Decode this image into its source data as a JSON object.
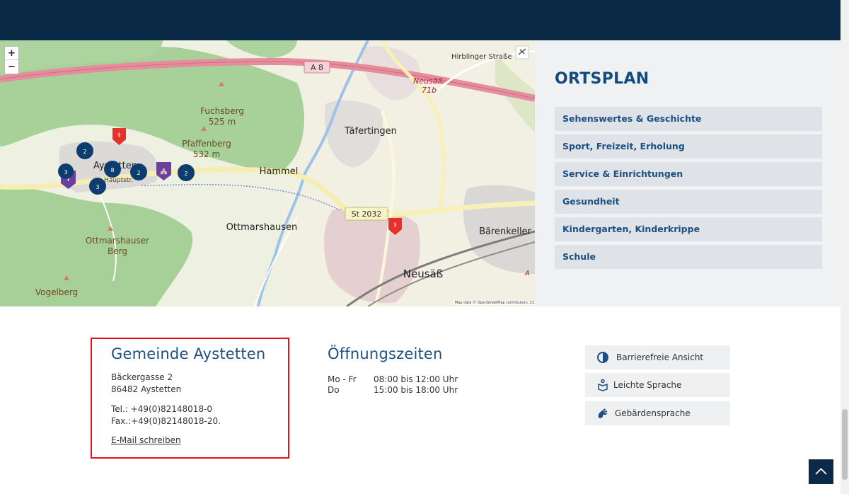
{
  "map": {
    "zoom_in": "+",
    "zoom_out": "−",
    "labels": {
      "a8": "A 8",
      "hirblinger": "Hirblinger Straße",
      "neusass71b_a": "Neusäß",
      "neusass71b_b": "71b",
      "fuchsberg_a": "Fuchsberg",
      "fuchsberg_b": "525 m",
      "pfaffenberg_a": "Pfaffenberg",
      "pfaffenberg_b": "532 m",
      "taefertingen": "Täfertingen",
      "aystetten": "Aystetten",
      "hauptstr": "Hauptstr.",
      "hammel": "Hammel",
      "st2032": "St 2032",
      "ottmarshausen": "Ottmarshausen",
      "baerenkeller": "Bärenkeller",
      "ottmarshauser_a": "Ottmarshauser",
      "ottmarshauser_b": "Berg",
      "neusass": "Neusäß",
      "vogelberg": "Vogelberg",
      "a_edge": "A"
    },
    "clusters": [
      "2",
      "3",
      "8",
      "2",
      "2",
      "3"
    ],
    "attribution": "Map data © OpenStreetMap contributors, CC-BY-SA"
  },
  "ortsplan": {
    "title": "ORTSPLAN",
    "items": [
      "Sehenswertes & Geschichte",
      "Sport, Freizeit, Erholung",
      "Service & Einrichtungen",
      "Gesundheit",
      "Kindergarten, Kinderkrippe",
      "Schule"
    ]
  },
  "gemeinde": {
    "title": "Gemeinde Aystetten",
    "street": "Bäckergasse 2",
    "city": "86482 Aystetten",
    "tel": "Tel.: +49(0)82148018-0",
    "fax": "Fax.:+49(0)82148018-20.",
    "email_link": "E-Mail schreiben"
  },
  "oeffnungszeiten": {
    "title": "Öffnungszeiten",
    "rows": [
      {
        "day": "Mo - Fr",
        "time": "08:00 bis 12:00 Uhr"
      },
      {
        "day": "Do",
        "time": "15:00 bis 18:00 Uhr"
      }
    ]
  },
  "accessibility": {
    "barrierefrei": "Barrierefreie Ansicht",
    "leichte_sprache": "Leichte Sprache",
    "gebaerdensprache": "Gebärdensprache"
  },
  "colors": {
    "navy": "#0b2a48",
    "accent_blue": "#1d4f82",
    "highlight_red": "#e0121b",
    "marker_blue": "#0d3d6e",
    "marker_purple": "#6b3fa0"
  }
}
